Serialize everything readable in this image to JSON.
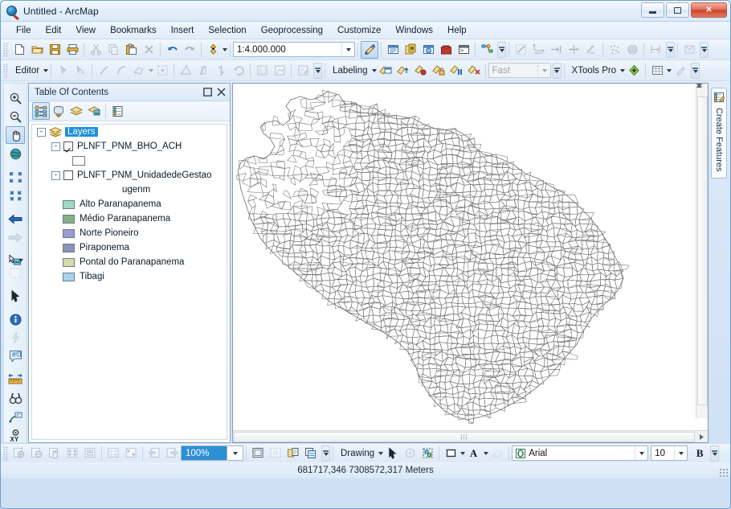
{
  "window": {
    "title": "Untitled - ArcMap",
    "app_icon": "arcmap-globe-icon",
    "minimize_label": "Minimize",
    "maximize_label": "Restore",
    "close_label": "✕"
  },
  "menubar": {
    "items": [
      {
        "label": "File",
        "accel": "F"
      },
      {
        "label": "Edit",
        "accel": "E"
      },
      {
        "label": "View",
        "accel": "V"
      },
      {
        "label": "Bookmarks",
        "accel": "B"
      },
      {
        "label": "Insert",
        "accel": "I"
      },
      {
        "label": "Selection",
        "accel": "S"
      },
      {
        "label": "Geoprocessing",
        "accel": "G"
      },
      {
        "label": "Customize",
        "accel": "C"
      },
      {
        "label": "Windows",
        "accel": "W"
      },
      {
        "label": "Help",
        "accel": "H"
      }
    ]
  },
  "standard_toolbar": {
    "buttons": [
      {
        "name": "new-map-icon",
        "tip": "New"
      },
      {
        "name": "open-icon",
        "tip": "Open"
      },
      {
        "name": "save-icon",
        "tip": "Save"
      },
      {
        "name": "print-icon",
        "tip": "Print"
      },
      {
        "name": "cut-icon",
        "tip": "Cut"
      },
      {
        "name": "copy-icon",
        "tip": "Copy"
      },
      {
        "name": "paste-icon",
        "tip": "Paste"
      },
      {
        "name": "delete-icon",
        "tip": "Delete"
      },
      {
        "name": "undo-icon",
        "tip": "Undo"
      },
      {
        "name": "redo-icon",
        "tip": "Redo"
      },
      {
        "name": "add-data-icon",
        "tip": "Add Data"
      }
    ],
    "scale": {
      "label": "Map Scale",
      "value": "1:4.000.000"
    },
    "right_buttons": [
      {
        "name": "editor-toolbar-icon",
        "tip": "Editor Toolbar"
      },
      {
        "name": "table-of-contents-icon",
        "tip": "Table Of Contents"
      },
      {
        "name": "catalog-icon",
        "tip": "Catalog"
      },
      {
        "name": "search-window-icon",
        "tip": "Search"
      },
      {
        "name": "arctoolbox-icon",
        "tip": "ArcToolbox"
      },
      {
        "name": "python-window-icon",
        "tip": "Python Window"
      },
      {
        "name": "model-builder-icon",
        "tip": "ModelBuilder"
      }
    ],
    "geostat_buttons": [
      {
        "name": "interpolate-line-icon",
        "tip": "Interpolate Line"
      },
      {
        "name": "profile-graph-icon",
        "tip": "Profile Graph"
      },
      {
        "name": "steepest-path-icon",
        "tip": "Steepest Path"
      },
      {
        "name": "line-of-sight-icon",
        "tip": "Line Of Sight"
      },
      {
        "name": "create-contour-icon",
        "tip": "Create Contour"
      },
      {
        "name": "point-cloud-icon",
        "tip": "Point Cloud"
      },
      {
        "name": "globe-surface-icon",
        "tip": "Surface"
      },
      {
        "name": "area-volume-icon",
        "tip": "Area and Volume"
      }
    ]
  },
  "editor_toolbar": {
    "menu_label": "Editor",
    "buttons": [
      {
        "name": "edit-tool-icon",
        "tip": "Edit Tool"
      },
      {
        "name": "edit-annotation-icon",
        "tip": "Edit Annotation Tool"
      },
      {
        "name": "straight-segment-icon",
        "tip": "Straight Segment"
      },
      {
        "name": "endpoint-arc-icon",
        "tip": "End Point Arc Segment"
      },
      {
        "name": "trace-icon",
        "tip": "Trace"
      },
      {
        "name": "edit-vertices-icon",
        "tip": "Edit Vertices"
      },
      {
        "name": "reshape-feature-icon",
        "tip": "Reshape Feature Tool"
      },
      {
        "name": "cut-polygons-icon",
        "tip": "Cut Polygons Tool"
      },
      {
        "name": "split-icon",
        "tip": "Split Tool"
      },
      {
        "name": "rotate-icon",
        "tip": "Rotate Tool"
      },
      {
        "name": "undo-edit-icon",
        "tip": "Undo"
      },
      {
        "name": "attributes-icon",
        "tip": "Attributes"
      },
      {
        "name": "sketch-properties-icon",
        "tip": "Sketch Properties"
      },
      {
        "name": "create-features-window-icon",
        "tip": "Create Features"
      }
    ]
  },
  "labeling_toolbar": {
    "menu_label": "Labeling",
    "buttons": [
      {
        "name": "label-manager-icon",
        "tip": "Label Manager"
      },
      {
        "name": "label-priority-icon",
        "tip": "Label Priority Ranking"
      },
      {
        "name": "label-weight-icon",
        "tip": "Label Weight Ranking"
      },
      {
        "name": "lock-labels-icon",
        "tip": "Lock Labels"
      },
      {
        "name": "pause-labeling-icon",
        "tip": "Pause Labeling"
      },
      {
        "name": "view-unplaced-labels-icon",
        "tip": "View Unplaced Labels"
      }
    ],
    "engine": {
      "label": "Label Engine",
      "value": "Fast"
    }
  },
  "xtools_toolbar": {
    "menu_label": "XTools Pro",
    "buttons": [
      {
        "name": "xtools-add-icon",
        "tip": "XTools Add"
      },
      {
        "name": "xtools-table-icon",
        "tip": "XTools Table"
      },
      {
        "name": "xtools-pencil-icon",
        "tip": "XTools Edit"
      }
    ]
  },
  "tools_toolbar": {
    "buttons": [
      {
        "name": "zoom-in-icon",
        "tip": "Zoom In",
        "state": "normal"
      },
      {
        "name": "zoom-out-icon",
        "tip": "Zoom Out",
        "state": "normal"
      },
      {
        "name": "pan-icon",
        "tip": "Pan",
        "state": "selected"
      },
      {
        "name": "full-extent-icon",
        "tip": "Full Extent",
        "state": "normal"
      },
      {
        "name": "fixed-zoom-in-icon",
        "tip": "Fixed Zoom In",
        "state": "normal"
      },
      {
        "name": "fixed-zoom-out-icon",
        "tip": "Fixed Zoom Out",
        "state": "normal"
      },
      {
        "name": "go-back-extent-icon",
        "tip": "Go Back To Previous Extent",
        "state": "normal"
      },
      {
        "name": "go-next-extent-icon",
        "tip": "Go To Next Extent",
        "state": "disabled"
      },
      {
        "name": "select-features-icon",
        "tip": "Select Features",
        "state": "normal"
      },
      {
        "name": "clear-selection-icon",
        "tip": "Clear Selected Features",
        "state": "disabled"
      },
      {
        "name": "select-elements-icon",
        "tip": "Select Elements",
        "state": "normal"
      },
      {
        "name": "identify-icon",
        "tip": "Identify",
        "state": "normal"
      },
      {
        "name": "hyperlink-icon",
        "tip": "Hyperlink",
        "state": "disabled"
      },
      {
        "name": "html-popup-icon",
        "tip": "HTML Popup",
        "state": "normal"
      },
      {
        "name": "measure-icon",
        "tip": "Measure",
        "state": "normal"
      },
      {
        "name": "find-icon",
        "tip": "Find",
        "state": "normal"
      },
      {
        "name": "find-route-icon",
        "tip": "Find Route",
        "state": "normal"
      },
      {
        "name": "go-to-xy-icon",
        "tip": "Go To XY",
        "state": "normal"
      }
    ]
  },
  "toc": {
    "title": "Table Of Contents",
    "header_buttons": [
      {
        "name": "toc-autohide-icon",
        "tip": "Auto Hide"
      },
      {
        "name": "toc-close-icon",
        "tip": "Close"
      }
    ],
    "toolbar_buttons": [
      {
        "name": "list-by-drawing-order-icon",
        "tip": "List By Drawing Order",
        "state": "selected"
      },
      {
        "name": "list-by-source-icon",
        "tip": "List By Source",
        "state": "normal"
      },
      {
        "name": "list-by-visibility-icon",
        "tip": "List By Visibility",
        "state": "normal"
      },
      {
        "name": "list-by-selection-icon",
        "tip": "List By Selection",
        "state": "normal"
      },
      {
        "name": "toc-options-icon",
        "tip": "Options",
        "state": "normal"
      }
    ],
    "tree": {
      "root": {
        "label": "Layers",
        "selected": true,
        "expander": "-"
      },
      "layers": [
        {
          "label": "PLNFT_PNM_BHO_ACH",
          "checked": true,
          "expander": "-",
          "symbol": "empty-polygon",
          "legend": []
        },
        {
          "label": "PLNFT_PNM_UnidadedeGestao",
          "label_line2": "ugenm",
          "checked": false,
          "expander": "-",
          "legend": [
            {
              "label": "Alto Paranapanema",
              "color": "#9ed9c3"
            },
            {
              "label": "Médio Paranapanema",
              "color": "#86b184"
            },
            {
              "label": "Norte Pioneiro",
              "color": "#9c9ad2"
            },
            {
              "label": "Piraponema",
              "color": "#8a94b4"
            },
            {
              "label": "Pontal do Paranapanema",
              "color": "#d7d9a8"
            },
            {
              "label": "Tibagi",
              "color": "#a8d4ea"
            }
          ]
        }
      ]
    }
  },
  "map": {
    "layer_outline_color": "#6e6e6e",
    "background_color": "#ffffff",
    "scrollbars": {
      "vertical_up": "▲",
      "vertical_down": "▼",
      "horizontal_right": "▶",
      "grip": "⦀"
    }
  },
  "right_dock": {
    "tab_label": "Create Features",
    "tab_icon": "create-features-icon"
  },
  "layout_toolbar": {
    "buttons": [
      {
        "name": "layout-zoom-in-icon",
        "tip": "Zoom In",
        "state": "disabled"
      },
      {
        "name": "layout-zoom-out-icon",
        "tip": "Zoom Out",
        "state": "disabled"
      },
      {
        "name": "layout-pan-icon",
        "tip": "Pan",
        "state": "disabled"
      },
      {
        "name": "layout-fixed-zoom-in-icon",
        "tip": "Fixed Zoom In",
        "state": "disabled"
      },
      {
        "name": "layout-fixed-zoom-out-icon",
        "tip": "Fixed Zoom Out",
        "state": "disabled"
      },
      {
        "name": "zoom-whole-page-icon",
        "tip": "Zoom Whole Page",
        "state": "disabled"
      },
      {
        "name": "zoom-100-percent-icon",
        "tip": "Zoom To 100%",
        "state": "disabled"
      },
      {
        "name": "go-back-layout-icon",
        "tip": "Go Back To Extent",
        "state": "disabled"
      },
      {
        "name": "go-forward-layout-icon",
        "tip": "Go Forward To Extent",
        "state": "disabled"
      },
      {
        "name": "toggle-draft-mode-icon",
        "tip": "Toggle Draft Mode",
        "state": "normal"
      },
      {
        "name": "focus-data-frame-icon",
        "tip": "Focus Data Frame",
        "state": "disabled"
      },
      {
        "name": "change-layout-icon",
        "tip": "Change Layout",
        "state": "normal"
      },
      {
        "name": "data-driven-pages-icon",
        "tip": "Data Driven Pages",
        "state": "normal"
      }
    ],
    "zoom": {
      "label": "Layout Zoom",
      "value": "100%",
      "selected": true
    }
  },
  "drawing_toolbar": {
    "menu_label": "Drawing",
    "buttons": [
      {
        "name": "select-elements-draw-icon",
        "tip": "Select Elements",
        "state": "normal"
      },
      {
        "name": "rotate-element-icon",
        "tip": "Rotate Element",
        "state": "disabled"
      },
      {
        "name": "group-elements-icon",
        "tip": "Group",
        "state": "normal"
      },
      {
        "name": "new-rectangle-icon",
        "tip": "New Rectangle",
        "state": "normal"
      },
      {
        "name": "fill-color-icon",
        "tip": "Fill Color",
        "state": "normal"
      },
      {
        "name": "font-color-icon",
        "tip": "Font Color",
        "state": "normal"
      },
      {
        "name": "new-text-icon",
        "tip": "New Text",
        "state": "disabled"
      }
    ],
    "font": {
      "label": "Font",
      "value": "Arial",
      "icon": "font-o-icon"
    },
    "size": {
      "label": "Font Size",
      "value": "10"
    },
    "bold": {
      "label": "B",
      "tip": "Bold"
    }
  },
  "statusbar": {
    "coordinates": "681717,346  7308572,317 Meters"
  }
}
